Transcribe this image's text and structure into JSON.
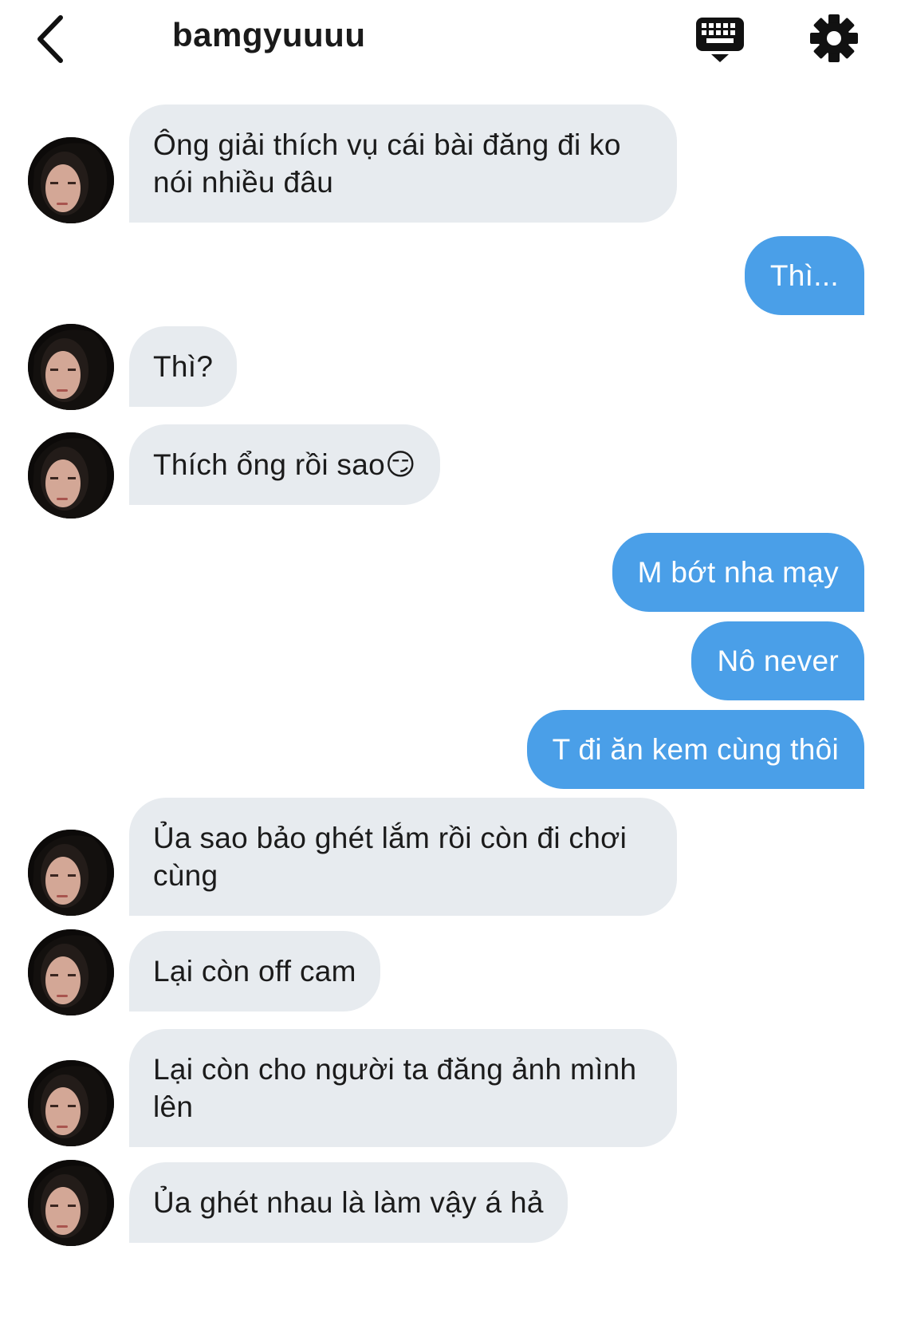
{
  "header": {
    "title": "bamgyuuuu",
    "icons": {
      "back": "chevron-left-icon",
      "keyboard": "keyboard-icon",
      "settings": "gear-icon"
    }
  },
  "colors": {
    "incoming_bubble": "#e7ebef",
    "outgoing_bubble": "#4a9fe8",
    "title_text": "#1a1a1a"
  },
  "messages": [
    {
      "from": "them",
      "text": "Ông giải thích vụ cái bài đăng đi ko nói nhiều đâu"
    },
    {
      "from": "me",
      "text": "Thì..."
    },
    {
      "from": "them",
      "text": "Thì?"
    },
    {
      "from": "them",
      "text": "Thích ổng rồi sao😏"
    },
    {
      "from": "me",
      "text": "M bớt nha mạy"
    },
    {
      "from": "me",
      "text": "Nô never"
    },
    {
      "from": "me",
      "text": "T đi ăn kem cùng thôi"
    },
    {
      "from": "them",
      "text": "Ủa sao bảo ghét lắm rồi còn đi chơi cùng"
    },
    {
      "from": "them",
      "text": "Lại còn off cam"
    },
    {
      "from": "them",
      "text": "Lại còn cho người ta đăng ảnh mình lên"
    },
    {
      "from": "them",
      "text": "Ủa ghét nhau là làm vậy á hả"
    }
  ]
}
